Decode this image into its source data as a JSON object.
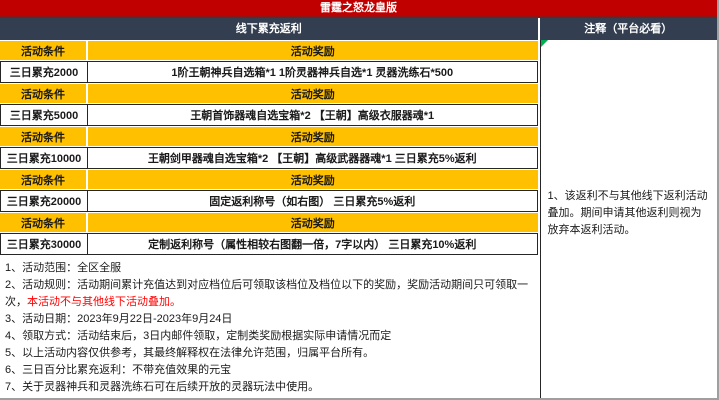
{
  "title": "雷霆之怒龙皇版",
  "left_table": {
    "header": "线下累充返利",
    "col_headers": {
      "condition": "活动条件",
      "reward": "活动奖励"
    },
    "rows": [
      {
        "condition": "三日累充2000",
        "reward": "1阶王朝神兵自选箱*1 1阶灵器神兵自选*1 灵器洗练石*500"
      },
      {
        "condition": "三日累充5000",
        "reward": "王朝首饰器魂自选宝箱*2 【王朝】高级衣服器魂*1"
      },
      {
        "condition": "三日累充10000",
        "reward": "王朝剑甲器魂自选宝箱*2 【王朝】高级武器器魂*1 三日累充5%返利"
      },
      {
        "condition": "三日累充20000",
        "reward": "固定返利称号（如右图） 三日累充5%返利"
      },
      {
        "condition": "三日累充30000",
        "reward": "定制返利称号（属性相较右图翻一倍，7字以内） 三日累充10%返利"
      }
    ]
  },
  "notes": {
    "n1": "1、活动范围：全区全服",
    "n2_prefix": "2、活动规则：活动期间累计充值达到对应档位后可领取该档位及档位以下的奖励，奖励活动期间只可领取一次，",
    "n2_highlight": "本活动不与其他线下活动叠加。",
    "n3": "3、活动日期：2023年9月22日-2023年9月24日",
    "n4": "4、领取方式：活动结束后，3日内邮件领取，定制类奖励根据实际申请情况而定",
    "n5": "5、以上活动内容仅供参考，其最终解释权在法律允许范围，归属平台所有。",
    "n6": "6、三日百分比累充返利：不带充值效果的元宝",
    "n7": "7、关于灵器神兵和灵器洗练石可在后续开放的灵器玩法中使用。"
  },
  "right_panel": {
    "header": "注释（平台必看）",
    "note": "1、该返利不与其他线下返利活动叠加。期间申请其他返利则视为放弃本返利活动。"
  },
  "colors": {
    "title_bg": "#c00000",
    "section_header_bg": "#333f50",
    "row_header_bg": "#ffc000",
    "highlight_text": "#ff0000",
    "comment_marker": "#00b050"
  }
}
